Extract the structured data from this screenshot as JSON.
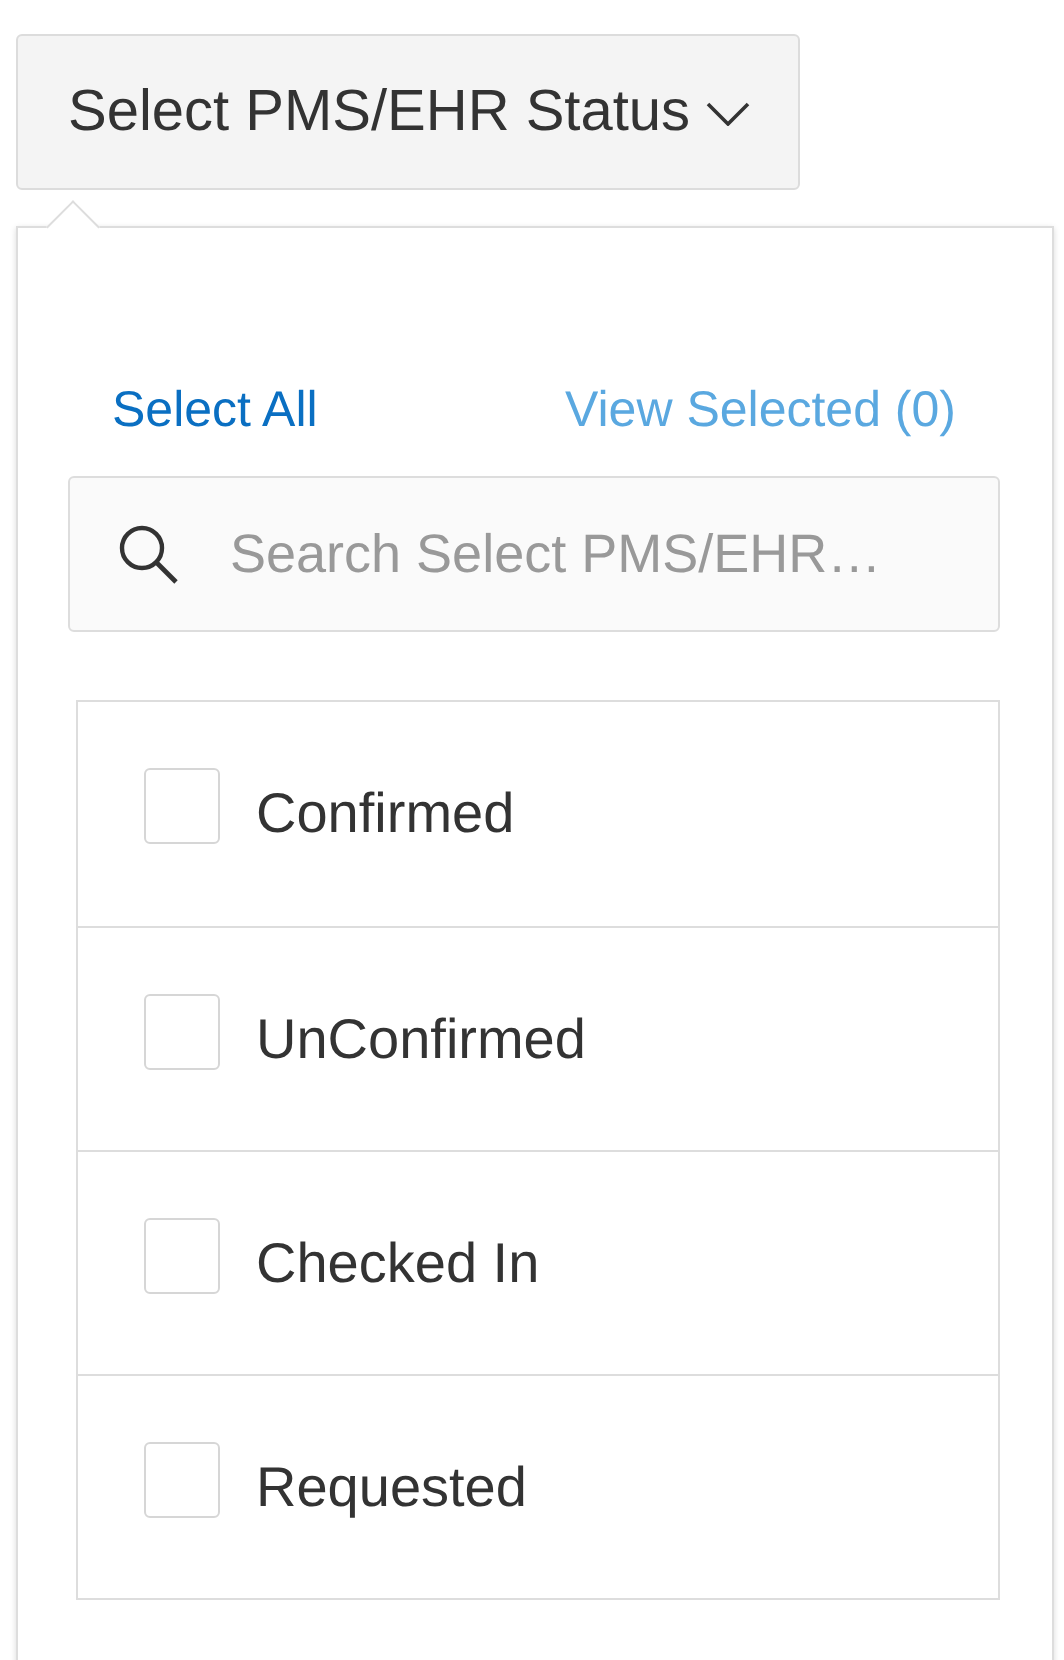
{
  "dropdown_button": {
    "label": "Select PMS/EHR Status",
    "expanded": true
  },
  "panel": {
    "select_all": "Select All",
    "view_selected": "View Selected (0)",
    "search": {
      "placeholder": "Search Select PMS/EHR…"
    },
    "options": [
      {
        "label": "Confirmed",
        "checked": false
      },
      {
        "label": "UnConfirmed",
        "checked": false
      },
      {
        "label": "Checked In",
        "checked": false
      },
      {
        "label": "Requested",
        "checked": false
      }
    ]
  }
}
